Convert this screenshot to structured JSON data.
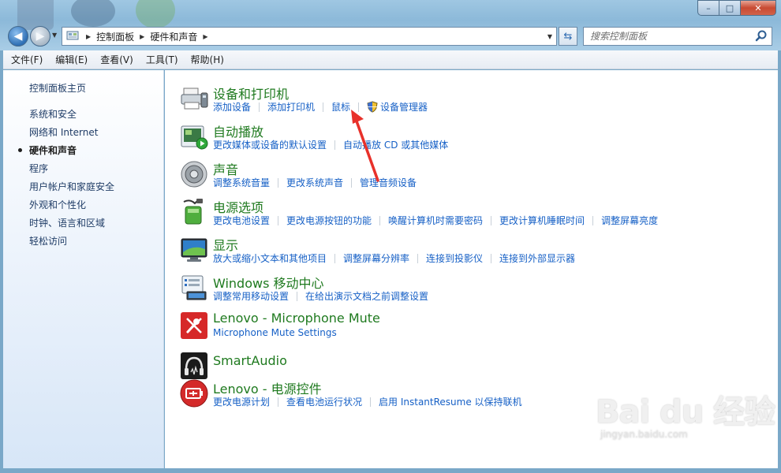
{
  "window": {
    "minimize_glyph": "–",
    "maximize_glyph": "□",
    "close_glyph": "✕"
  },
  "nav": {
    "back_glyph": "◀",
    "forward_glyph": "▶",
    "dropdown_glyph": "▼"
  },
  "address": {
    "crumbs": [
      "控制面板",
      "硬件和声音"
    ],
    "separator": "▶",
    "dropdown_glyph": "▼"
  },
  "refresh_glyph": "⇆",
  "search": {
    "placeholder": "搜索控制面板"
  },
  "menu": [
    "文件(F)",
    "编辑(E)",
    "查看(V)",
    "工具(T)",
    "帮助(H)"
  ],
  "sidebar": {
    "home": "控制面板主页",
    "items": [
      "系统和安全",
      "网络和 Internet",
      "硬件和声音",
      "程序",
      "用户帐户和家庭安全",
      "外观和个性化",
      "时钟、语言和区域",
      "轻松访问"
    ],
    "active_index": 2
  },
  "categories": [
    {
      "title": "设备和打印机",
      "icon": "printer-icon",
      "links": [
        "添加设备",
        "添加打印机",
        "鼠标",
        "设备管理器"
      ]
    },
    {
      "title": "自动播放",
      "icon": "autoplay-icon",
      "links": [
        "更改媒体或设备的默认设置",
        "自动播放 CD 或其他媒体"
      ]
    },
    {
      "title": "声音",
      "icon": "speaker-icon",
      "links": [
        "调整系统音量",
        "更改系统声音",
        "管理音频设备"
      ]
    },
    {
      "title": "电源选项",
      "icon": "power-options-icon",
      "links": [
        "更改电池设置",
        "更改电源按钮的功能",
        "唤醒计算机时需要密码",
        "更改计算机睡眠时间",
        "调整屏幕亮度"
      ]
    },
    {
      "title": "显示",
      "icon": "display-icon",
      "links": [
        "放大或缩小文本和其他项目",
        "调整屏幕分辨率",
        "连接到投影仪",
        "连接到外部显示器"
      ]
    },
    {
      "title": "Windows 移动中心",
      "icon": "mobility-center-icon",
      "links": [
        "调整常用移动设置",
        "在给出演示文档之前调整设置"
      ]
    },
    {
      "title": "Lenovo - Microphone Mute",
      "icon": "microphone-mute-icon",
      "links": [
        "Microphone Mute Settings"
      ]
    },
    {
      "title": "SmartAudio",
      "icon": "headphones-icon",
      "links": []
    },
    {
      "title": "Lenovo - 电源控件",
      "icon": "battery-icon",
      "links": [
        "更改电源计划",
        "查看电池运行状况",
        "启用 InstantResume 以保持联机"
      ]
    }
  ],
  "colors": {
    "category_title": "#1f7a1f",
    "link": "#1660c6",
    "annotation_arrow": "#e8312a"
  },
  "watermark": {
    "logo": "Bai du 经验",
    "url": "jingyan.baidu.com"
  }
}
